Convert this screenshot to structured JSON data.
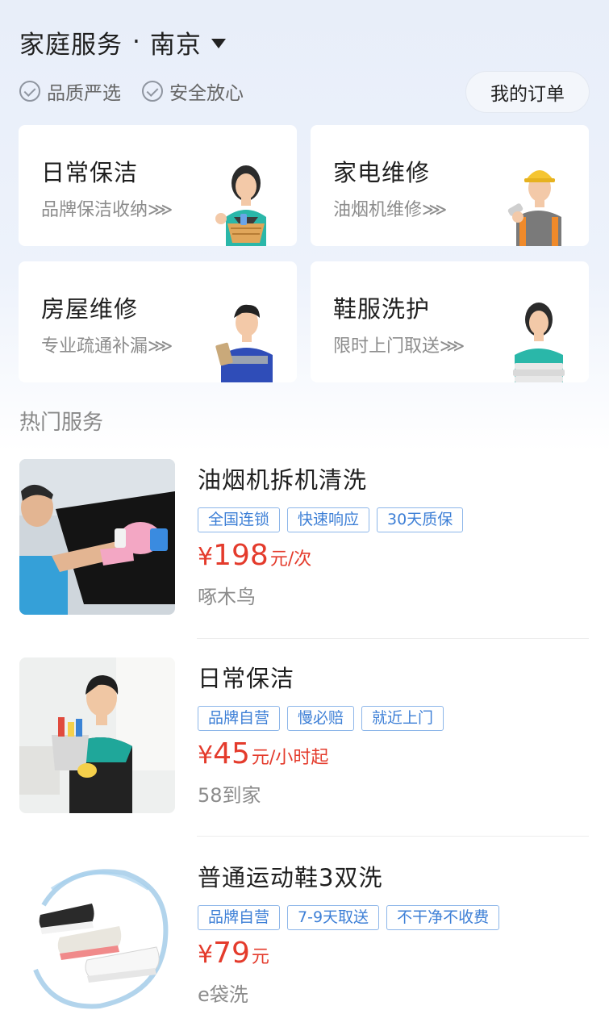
{
  "header": {
    "title": "家庭服务",
    "separator": "·",
    "city": "南京"
  },
  "badges": [
    {
      "label": "品质严选"
    },
    {
      "label": "安全放心"
    }
  ],
  "orders_button": "我的订单",
  "categories": [
    {
      "title": "日常保洁",
      "subtitle": "品牌保洁收纳⋙"
    },
    {
      "title": "家电维修",
      "subtitle": "油烟机维修⋙"
    },
    {
      "title": "房屋维修",
      "subtitle": "专业疏通补漏⋙"
    },
    {
      "title": "鞋服洗护",
      "subtitle": "限时上门取送⋙"
    }
  ],
  "hot_section_title": "热门服务",
  "services": [
    {
      "name": "油烟机拆机清洗",
      "tags": [
        "全国连锁",
        "快速响应",
        "30天质保"
      ],
      "currency": "¥",
      "price": "198",
      "unit": "元/次",
      "vendor": "啄木鸟"
    },
    {
      "name": "日常保洁",
      "tags": [
        "品牌自营",
        "慢必赔",
        "就近上门"
      ],
      "currency": "¥",
      "price": "45",
      "unit": "元/小时起",
      "vendor": "58到家"
    },
    {
      "name": "普通运动鞋3双洗",
      "tags": [
        "品牌自营",
        "7-9天取送",
        "不干净不收费"
      ],
      "currency": "¥",
      "price": "79",
      "unit": "元",
      "vendor": "e袋洗"
    }
  ],
  "colors": {
    "accent_price": "#e43b2c",
    "tag_blue": "#3d7fd6",
    "bg_top": "#e8eef9"
  }
}
